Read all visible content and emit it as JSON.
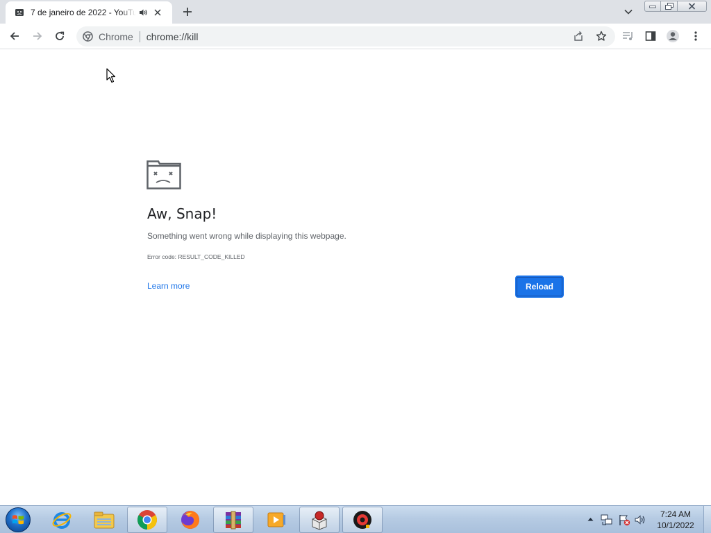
{
  "browser": {
    "tab": {
      "title": "7 de janeiro de 2022 - YouTube",
      "favicon": "video-thumbnail-icon",
      "audio_icon": "speaker-icon"
    },
    "omnibox": {
      "chip": "Chrome",
      "url": "chrome://kill"
    }
  },
  "crash_page": {
    "title": "Aw, Snap!",
    "message": "Something went wrong while displaying this webpage.",
    "error_code": "Error code: RESULT_CODE_KILLED",
    "learn_more": "Learn more",
    "reload": "Reload",
    "accent_color": "#1a73e8"
  },
  "taskbar": {
    "items": [
      "internet-explorer-icon",
      "file-explorer-icon",
      "chrome-icon",
      "firefox-icon",
      "winrar-icon",
      "media-player-icon",
      "installer-icon",
      "screen-recorder-icon"
    ],
    "tray": [
      "network-icon",
      "action-center-icon",
      "volume-icon"
    ],
    "clock": {
      "time": "7:24 AM",
      "date": "10/1/2022"
    }
  }
}
